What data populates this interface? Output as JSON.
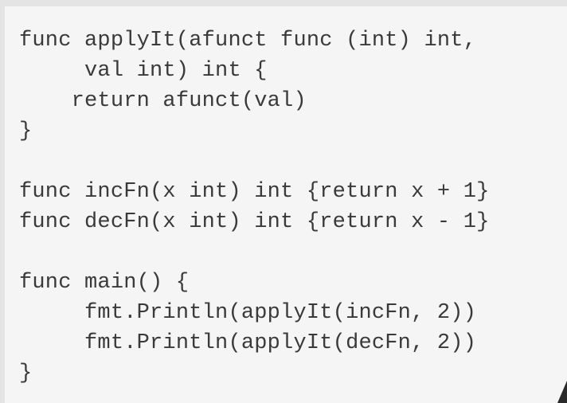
{
  "code": {
    "lines": [
      "func applyIt(afunct func (int) int,",
      "     val int) int {",
      "    return afunct(val)",
      "}",
      "",
      "func incFn(x int) int {return x + 1}",
      "func decFn(x int) int {return x - 1}",
      "",
      "func main() {",
      "     fmt.Println(applyIt(incFn, 2))",
      "     fmt.Println(applyIt(decFn, 2))",
      "}"
    ]
  }
}
